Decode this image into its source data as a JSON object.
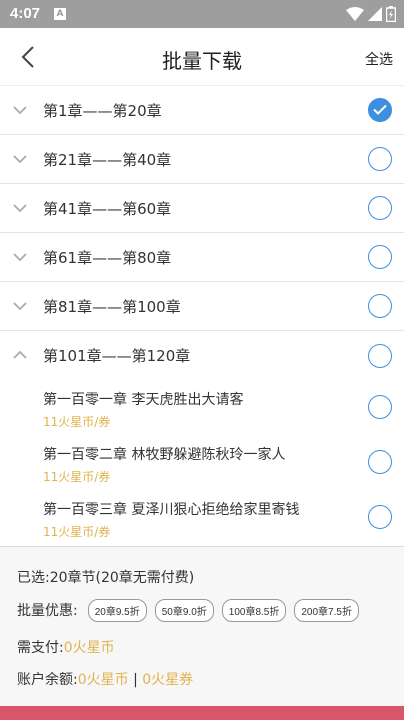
{
  "status_bar": {
    "time": "4:07",
    "notification_letter": "A"
  },
  "header": {
    "title": "批量下载",
    "select_all": "全选"
  },
  "groups": [
    {
      "label": "第1章——第20章",
      "checked": true,
      "expanded": false
    },
    {
      "label": "第21章——第40章",
      "checked": false,
      "expanded": false
    },
    {
      "label": "第41章——第60章",
      "checked": false,
      "expanded": false
    },
    {
      "label": "第61章——第80章",
      "checked": false,
      "expanded": false
    },
    {
      "label": "第81章——第100章",
      "checked": false,
      "expanded": false
    },
    {
      "label": "第101章——第120章",
      "checked": false,
      "expanded": true
    }
  ],
  "sub_chapters": [
    {
      "title": "第一百零一章 李天虎胜出大请客",
      "price": "11火星币/券",
      "checked": false
    },
    {
      "title": "第一百零二章 林牧野躲避陈秋玲一家人",
      "price": "11火星币/券",
      "checked": false
    },
    {
      "title": "第一百零三章 夏泽川狠心拒绝给家里寄钱",
      "price": "11火星币/券",
      "checked": false
    }
  ],
  "footer": {
    "selected_info": "已选:20章节(20章无需付费)",
    "discount_label": "批量优惠:",
    "discounts": [
      "20章9.5折",
      "50章9.0折",
      "100章8.5折",
      "200章7.5折"
    ],
    "pay_label": "需支付:",
    "pay_value": "0火星币",
    "balance_label": "账户余额:",
    "balance_coins": "0火星币",
    "balance_separator": "|",
    "balance_coupons": "0火星券"
  },
  "colors": {
    "accent_blue": "#3d8fe0",
    "price_gold": "#e0b34f",
    "button_red": "#d9576a",
    "status_bar": "#9e9e9e"
  },
  "icons": {
    "back": "chevron-left-icon",
    "collapsed": "chevron-down-icon",
    "expanded": "chevron-up-icon",
    "checked": "check-icon"
  }
}
